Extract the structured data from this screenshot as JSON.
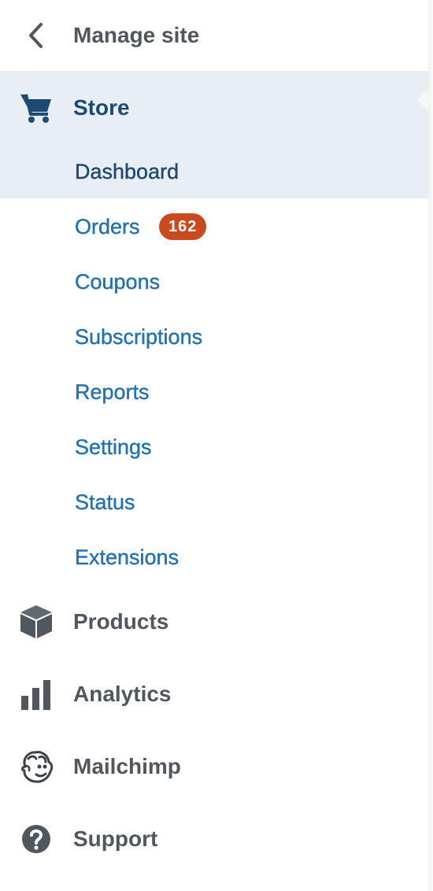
{
  "header": {
    "back_label": "Manage site",
    "back_icon": "chevron-left-icon"
  },
  "store": {
    "label": "Store",
    "icon": "cart-icon",
    "color": "#1d4a73",
    "highlight": "#e8eef4",
    "submenu": [
      {
        "label": "Dashboard",
        "active": true
      },
      {
        "label": "Orders",
        "badge": "162"
      },
      {
        "label": "Coupons"
      },
      {
        "label": "Subscriptions"
      },
      {
        "label": "Reports"
      },
      {
        "label": "Settings"
      },
      {
        "label": "Status"
      },
      {
        "label": "Extensions"
      }
    ]
  },
  "menu": [
    {
      "label": "Products",
      "icon": "box-icon"
    },
    {
      "label": "Analytics",
      "icon": "bar-chart-icon"
    },
    {
      "label": "Mailchimp",
      "icon": "mailchimp-icon"
    },
    {
      "label": "Support",
      "icon": "help-icon"
    }
  ],
  "colors": {
    "link": "#2271b1",
    "text": "#50575e",
    "badge": "#ca4a1f"
  }
}
